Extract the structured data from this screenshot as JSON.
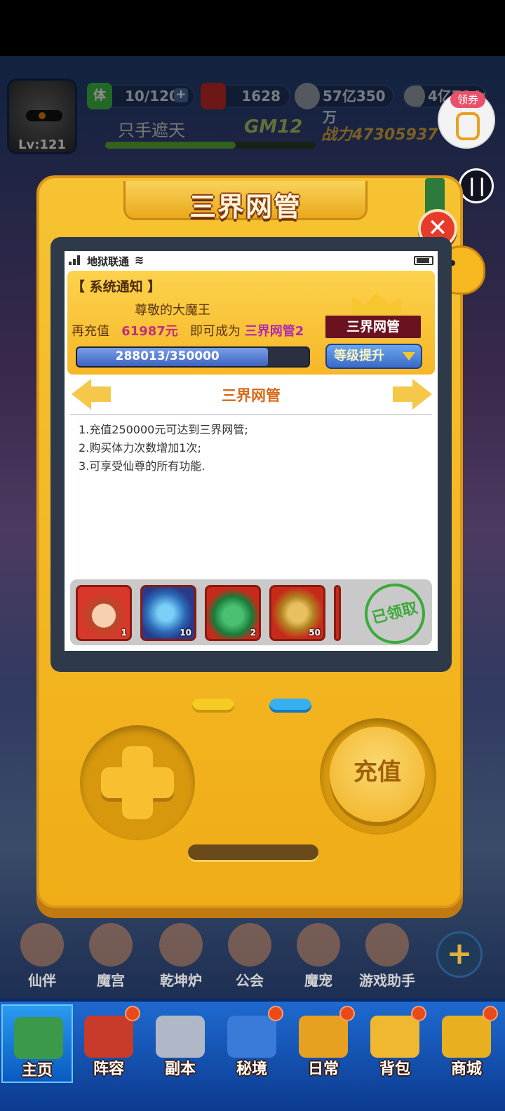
{
  "hud": {
    "level": "Lv:121",
    "stamina": "10/120",
    "stamina_icon": "体",
    "gift_value": "1628",
    "coins": "57亿350万",
    "gems": "4亿7044万",
    "player_name": "只手遮天",
    "gm_level": "GM12",
    "power": "战力47305937",
    "coupon_label": "领券",
    "exp_fraction": 0.62
  },
  "panel": {
    "title": "三界网管",
    "status_bar": {
      "carrier": "地狱联通"
    },
    "notice": {
      "header": "【 系统通知 】",
      "greeting": "尊敬的大魔王",
      "recharge_prefix": "再充值",
      "recharge_amount": "61987元",
      "recharge_middle": "即可成为",
      "next_rank": "三界网管2",
      "progress_text": "288013/350000",
      "progress_value": 288013,
      "progress_max": 350000,
      "rank_badge": "三界网管",
      "level_up_button": "等级提升"
    },
    "tier_name": "三界网管",
    "benefits": [
      "1.充值250000元可达到三界网管;",
      "2.购买体力次数增加1次;",
      "3.可享受仙尊的所有功能."
    ],
    "rewards": [
      {
        "name": "hero-portrait",
        "count": "1"
      },
      {
        "name": "shark",
        "count": "10"
      },
      {
        "name": "red-envelope-stone",
        "count": "2"
      },
      {
        "name": "golden-dragon",
        "count": "50"
      }
    ],
    "claimed_stamp": "已领取",
    "charge_button": "充值"
  },
  "bg_icons": [
    "仙伴",
    "魔宫",
    "乾坤炉",
    "公会",
    "魔宠",
    "游戏助手"
  ],
  "bottom_nav": [
    "主页",
    "阵容",
    "副本",
    "秘境",
    "日常",
    "背包",
    "商城"
  ],
  "colors": {
    "panel_yellow": "#f6c332",
    "accent_red": "#e83a2a",
    "progress_blue": "#3e64c0",
    "claimed_green": "#3aaa3a"
  }
}
